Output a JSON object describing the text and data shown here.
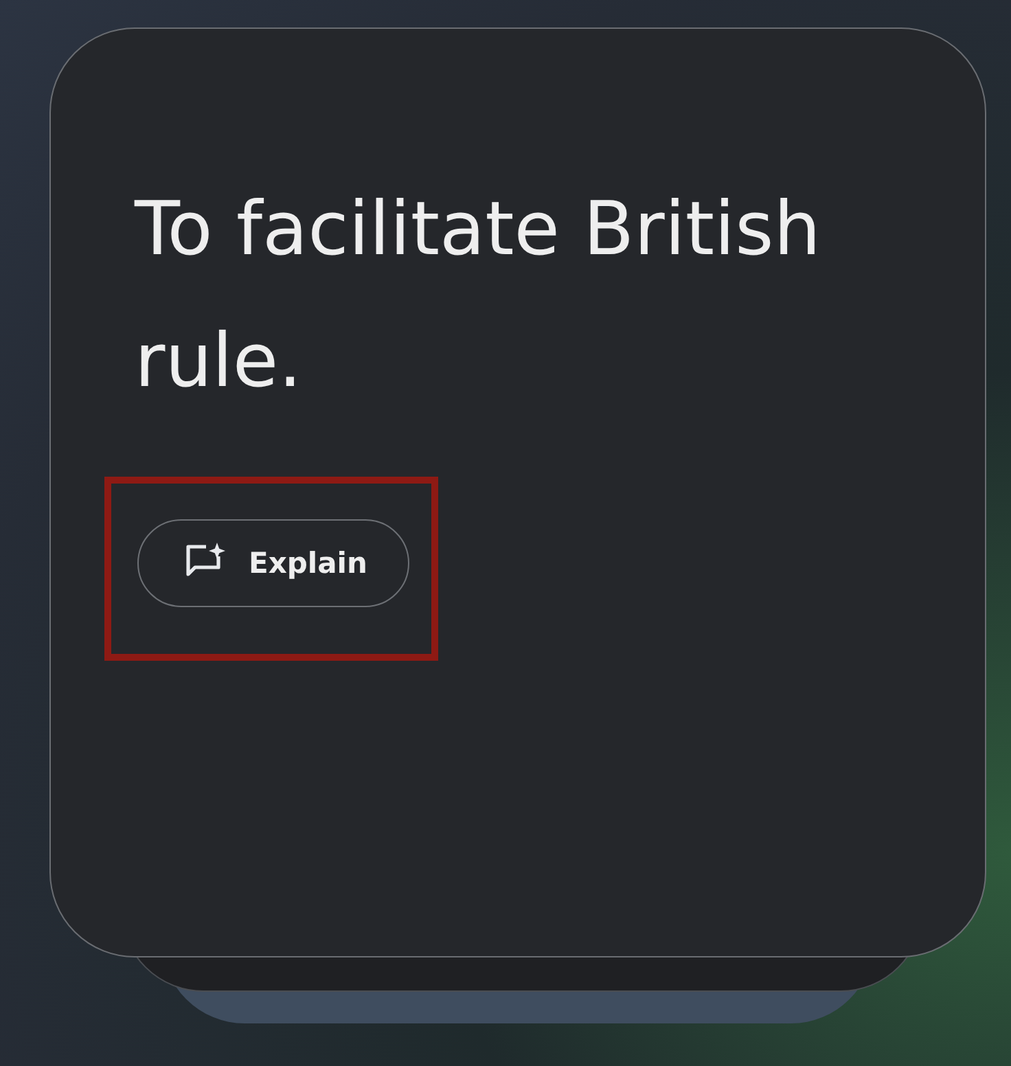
{
  "card": {
    "heading": "To facilitate British rule.",
    "button": {
      "label": "Explain",
      "highlighted": true
    }
  }
}
